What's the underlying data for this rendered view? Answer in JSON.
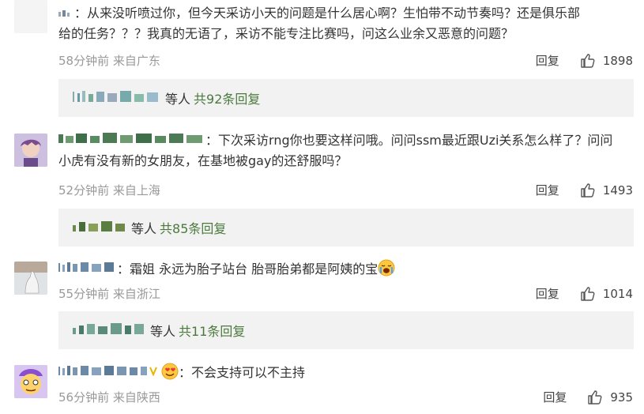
{
  "comments": [
    {
      "username_suffix": "：",
      "text_line1": "从来没听喷过你，但今天采访小天的问题是什么居心啊？生怕带不动节奏吗？还是俱乐部",
      "text_line2": "给的任务？？？我真的无语了，采访不能专注比赛吗，问这么业余又恶意的问题？",
      "time_source": "58分钟前 来自广东",
      "reply_label": "回复",
      "likes": "1898",
      "thread": {
        "others": "等人",
        "total": "共92条回复"
      }
    },
    {
      "username_suffix": "：",
      "text_line1": "下次采访rng你也要这样问哦。问问ssm最近跟Uzi关系怎么样了？问问",
      "text_line2": "小虎有没有新的女朋友，在基地被gay的还舒服吗？",
      "time_source": "52分钟前 来自上海",
      "reply_label": "回复",
      "likes": "1493",
      "thread": {
        "others": "等人",
        "total": "共85条回复"
      }
    },
    {
      "username_suffix": "：",
      "text_line1": "霜姐 永远为胎子站台 胎哥胎弟都是阿姨的宝",
      "time_source": "55分钟前 来自浙江",
      "reply_label": "回复",
      "likes": "1014",
      "thread": {
        "others": "等人",
        "total": "共11条回复"
      }
    },
    {
      "username_suffix": "：",
      "text_line1": "不会支持可以不主持",
      "time_source": "56分钟前 来自陕西",
      "reply_label": "回复",
      "likes": "935"
    }
  ],
  "icons": {
    "like": "thumbs-up-icon",
    "emoji_cry": "crying-face-emoji",
    "emoji_love": "heart-eyes-emoji"
  },
  "colors": {
    "meta": "#999999",
    "link_green": "#4a7a3c",
    "thread_bg": "#f2f2f2"
  }
}
